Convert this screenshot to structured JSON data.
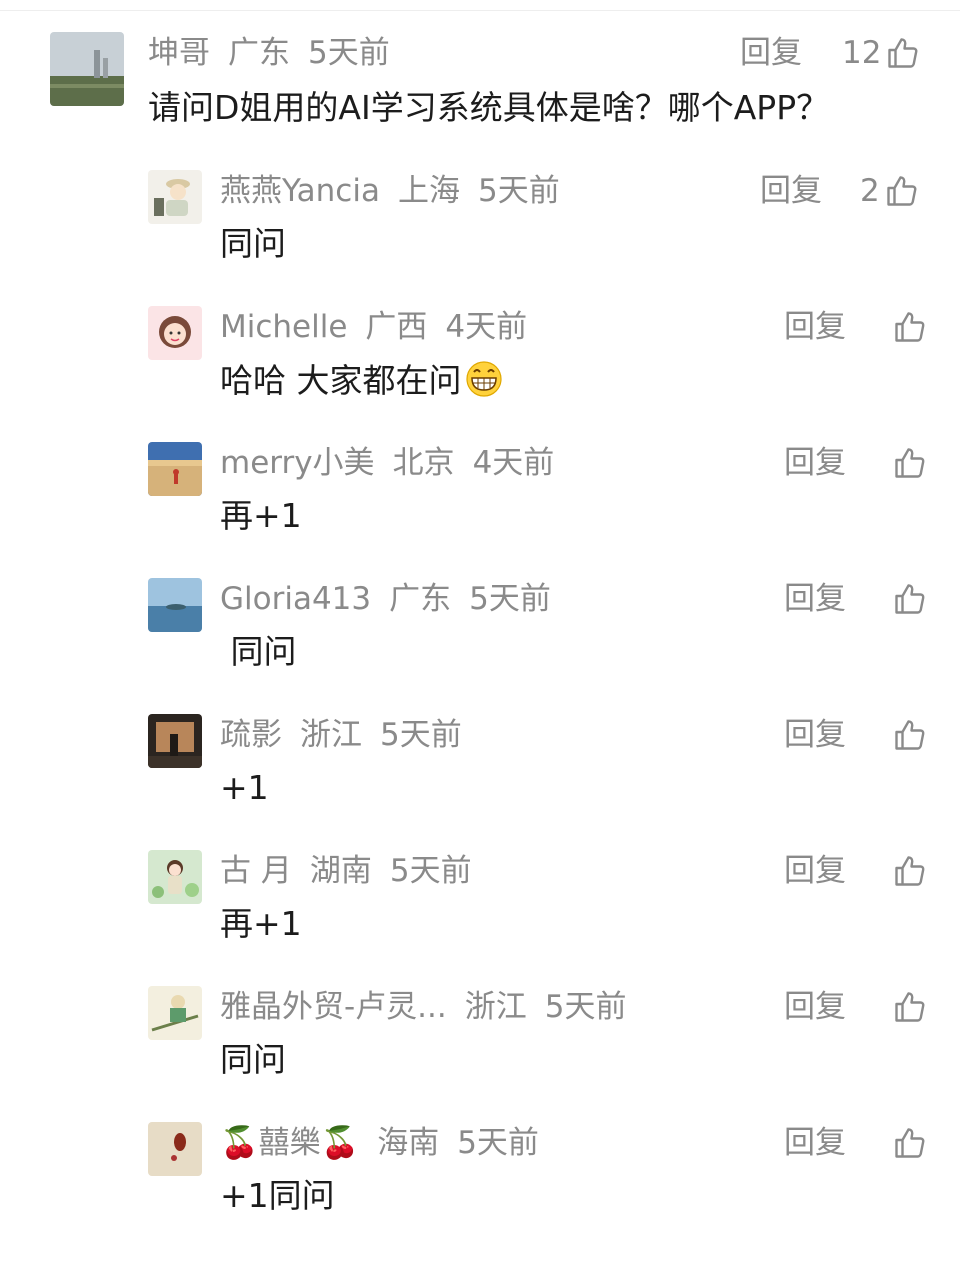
{
  "main_comment": {
    "author": "坤哥",
    "location": "广东",
    "time": "5天前",
    "text": "请问D姐用的AI学习系统具体是啥？哪个APP？",
    "reply_label": "回复",
    "likes": "12",
    "avatar_icon": "avatar-landscape-city"
  },
  "replies": [
    {
      "author": "燕燕Yancia",
      "location": "上海",
      "time": "5天前",
      "text": "同问",
      "reply_label": "回复",
      "likes": "2",
      "avatar_icon": "avatar-cartoon-traveler"
    },
    {
      "author": "Michelle",
      "location": "广西",
      "time": "4天前",
      "text": "哈哈 大家都在问",
      "reply_label": "回复",
      "likes": "",
      "avatar_icon": "avatar-cartoon-girl",
      "emoji": "grinning-emoji"
    },
    {
      "author": "merry小美",
      "location": "北京",
      "time": "4天前",
      "text": "再+1",
      "reply_label": "回复",
      "likes": "",
      "avatar_icon": "avatar-desert-photo"
    },
    {
      "author": "Gloria413",
      "location": "广东",
      "time": "5天前",
      "text": " 同问",
      "reply_label": "回复",
      "likes": "",
      "avatar_icon": "avatar-sea-island"
    },
    {
      "author": "疏影",
      "location": "浙江",
      "time": "5天前",
      "text": "+1",
      "reply_label": "回复",
      "likes": "",
      "avatar_icon": "avatar-dusk-photo"
    },
    {
      "author": "古 月",
      "location": "湖南",
      "time": "5天前",
      "text": "再+1",
      "reply_label": "回复",
      "likes": "",
      "avatar_icon": "avatar-girl-garden"
    },
    {
      "author": "雅晶外贸-卢灵...",
      "location": "浙江",
      "time": "5天前",
      "text": "同问",
      "reply_label": "回复",
      "likes": "",
      "avatar_icon": "avatar-painting"
    },
    {
      "author": "🍒囍樂🍒",
      "location": "海南",
      "time": "5天前",
      "text": "+1同问",
      "reply_label": "回复",
      "likes": "",
      "avatar_icon": "avatar-beige-object"
    }
  ],
  "colors": {
    "meta_gray": "#8a8a8a",
    "body_text": "#1c1c1c",
    "background": "#ffffff"
  }
}
